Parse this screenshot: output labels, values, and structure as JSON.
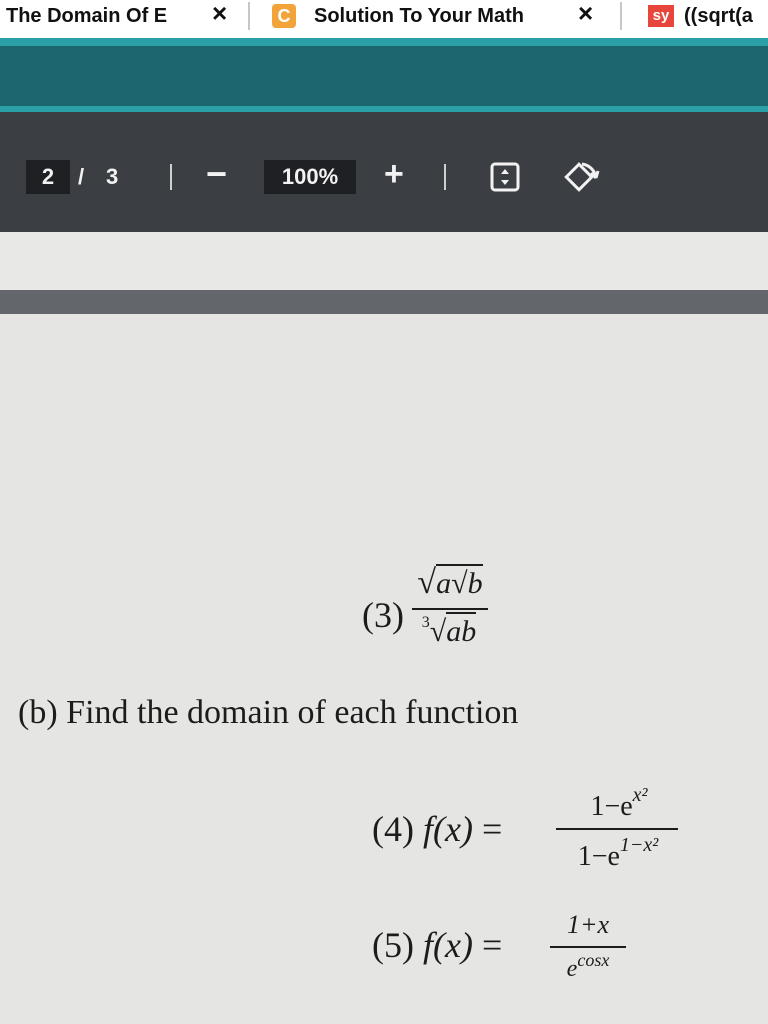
{
  "tabs": [
    {
      "title": "The Domain Of E",
      "close": "×"
    },
    {
      "favicon": "C",
      "title": "Solution To Your Math",
      "close": "×"
    },
    {
      "favicon": "sy",
      "title": "((sqrt(a"
    }
  ],
  "toolbar": {
    "current_page": "2",
    "page_separator": "/",
    "total_pages": "3",
    "zoom_out": "−",
    "zoom_level": "100%",
    "zoom_in": "+",
    "fit_icon": "fit-to-page-icon",
    "rotate_icon": "rotate-icon"
  },
  "document": {
    "item3": {
      "label": "(3)",
      "numerator_a": "a",
      "numerator_b": "b",
      "denominator_index": "3",
      "denominator_radicand": "ab"
    },
    "part_b": {
      "label": "(b)",
      "text": "Find the domain of each function"
    },
    "item4": {
      "label": "(4)",
      "lhs": "f(x)",
      "equals": "=",
      "numerator": "1−e",
      "numerator_exp": "x²",
      "denominator": "1−e",
      "denominator_exp": "1−x²"
    },
    "item5": {
      "label": "(5)",
      "lhs": "f(x)",
      "equals": "=",
      "numerator": "1+x",
      "denominator": "e",
      "denominator_exp": "cosx"
    }
  },
  "colors": {
    "teal_accent": "#2a9fa6",
    "teal_band": "#1d6670",
    "toolbar_bg": "#3b3e43",
    "page_bg": "#e5e6e4"
  }
}
